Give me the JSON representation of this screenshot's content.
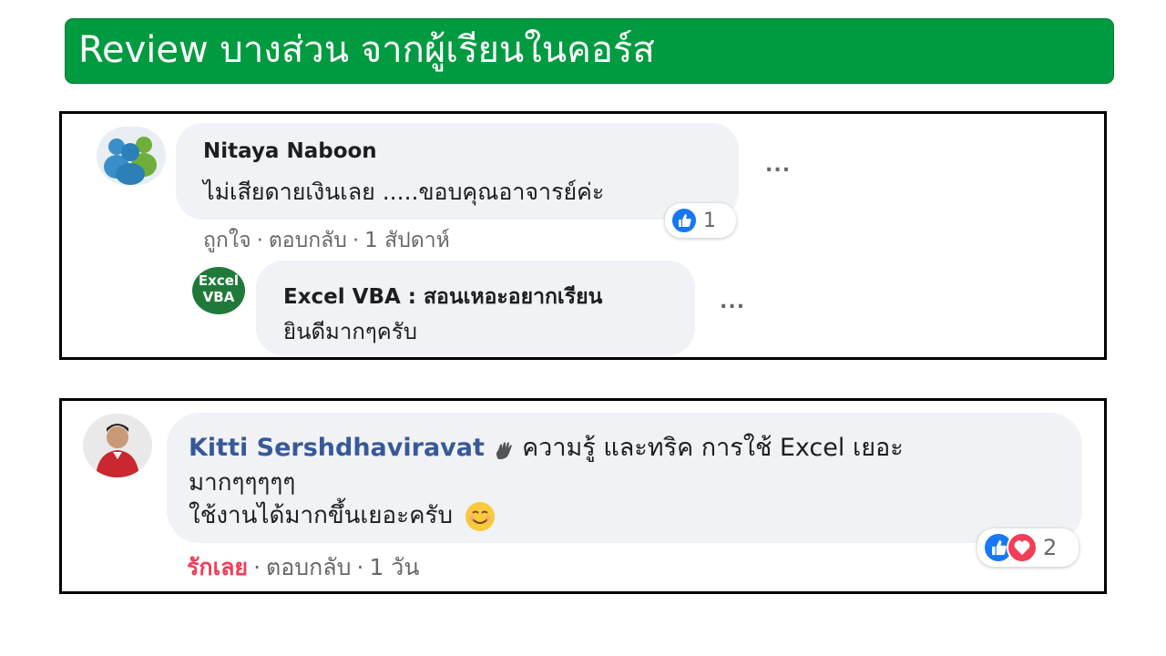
{
  "banner": {
    "title": "Review บางส่วน จากผู้เรียนในคอร์ส",
    "color": "#009b40"
  },
  "comments": [
    {
      "author": "Nitaya Naboon",
      "avatar_icon": "msn-people-icon",
      "text": "ไม่เสียดายเงินเลย .....ขอบคุณอาจารย์ค่ะ",
      "more": "...",
      "actions": {
        "like": "ถูกใจ",
        "reply": "ตอบกลับ",
        "time": "1 สัปดาห์"
      },
      "reactions": {
        "icons": [
          "like-icon"
        ],
        "count": "1"
      },
      "reply": {
        "author": "Excel VBA : สอนเหอะอยากเรียน",
        "avatar_text_top": "Excel",
        "avatar_text_bottom": "VBA",
        "text": "ยินดีมากๆครับ",
        "more": "..."
      }
    },
    {
      "author": "Kitti Sershdhaviravat",
      "avatar_icon": "profile-photo",
      "text_line1": "ความรู้ และทริค การใช้ Excel เยอะ",
      "text_line2": "มากๆๆๆๆๆ",
      "text_line3": "ใช้งานได้มากขึ้นเยอะครับ",
      "emoji": "😊",
      "actions": {
        "like": "รักเลย",
        "reply": "ตอบกลับ",
        "time": "1 วัน"
      },
      "reactions": {
        "icons": [
          "like-icon",
          "love-icon"
        ],
        "count": "2"
      }
    }
  ],
  "colors": {
    "like_blue": "#1877f2",
    "love_red": "#f33e58",
    "love_text": "#f33e58",
    "name_blue": "#385898"
  }
}
